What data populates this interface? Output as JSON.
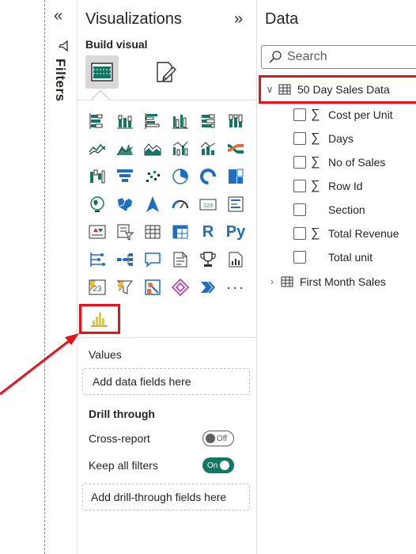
{
  "filters": {
    "label": "Filters",
    "collapse_icon": "double-chevron-left-icon",
    "funnel_icon": "funnel-icon"
  },
  "visualizations": {
    "title": "Visualizations",
    "expand_icon": "double-chevron-right-icon",
    "build_label": "Build visual",
    "build_tabs": [
      "build-visual-icon",
      "format-visual-icon"
    ],
    "icons": [
      "stacked-bar-chart-icon",
      "stacked-column-chart-icon",
      "clustered-bar-chart-icon",
      "clustered-column-chart-icon",
      "100-stacked-bar-chart-icon",
      "100-stacked-column-chart-icon",
      "line-chart-icon",
      "area-chart-icon",
      "stacked-area-chart-icon",
      "line-clustered-column-icon",
      "line-stacked-column-icon",
      "ribbon-chart-icon",
      "waterfall-chart-icon",
      "funnel-chart-icon",
      "scatter-chart-icon",
      "pie-chart-icon",
      "donut-chart-icon",
      "treemap-icon",
      "map-icon",
      "filled-map-icon",
      "azure-map-icon",
      "gauge-icon",
      "card-icon",
      "multi-row-card-icon",
      "kpi-icon",
      "slicer-icon",
      "table-icon",
      "matrix-icon",
      "r-visual-icon",
      "python-visual-icon",
      "key-influencers-icon",
      "decomposition-tree-icon",
      "qa-icon",
      "smart-narrative-icon",
      "metrics-icon",
      "paginated-report-icon",
      "power-apps-icon",
      "power-automate-icon",
      "custom-visual-icon",
      "diamond-visual-icon",
      "chevron-visual-icon",
      "more-visuals-icon"
    ],
    "custom_visual_icon": "yellow-column-chart-icon",
    "values_label": "Values",
    "values_placeholder": "Add data fields here",
    "drill_title": "Drill through",
    "cross_report": "Cross-report",
    "cross_report_state": "Off",
    "keep_filters": "Keep all filters",
    "keep_filters_state": "On",
    "drill_placeholder": "Add drill-through fields here"
  },
  "data": {
    "title": "Data",
    "search_placeholder": "Search",
    "tables": [
      {
        "name": "50 Day Sales Data",
        "expanded": true,
        "fields": [
          {
            "name": "Cost per Unit",
            "sigma": "∑"
          },
          {
            "name": "Days",
            "sigma": "∑"
          },
          {
            "name": "No of Sales",
            "sigma": "∑"
          },
          {
            "name": "Row Id",
            "sigma": "∑"
          },
          {
            "name": "Section",
            "sigma": ""
          },
          {
            "name": "Total Revenue",
            "sigma": "∑"
          },
          {
            "name": "Total unit",
            "sigma": ""
          }
        ]
      },
      {
        "name": "First Month Sales",
        "expanded": false
      }
    ]
  },
  "colors": {
    "highlight": "#e8111c",
    "toggle_on": "#117865",
    "accent_blue": "#1f6ebf",
    "chart_yellow": "#f2c811"
  }
}
